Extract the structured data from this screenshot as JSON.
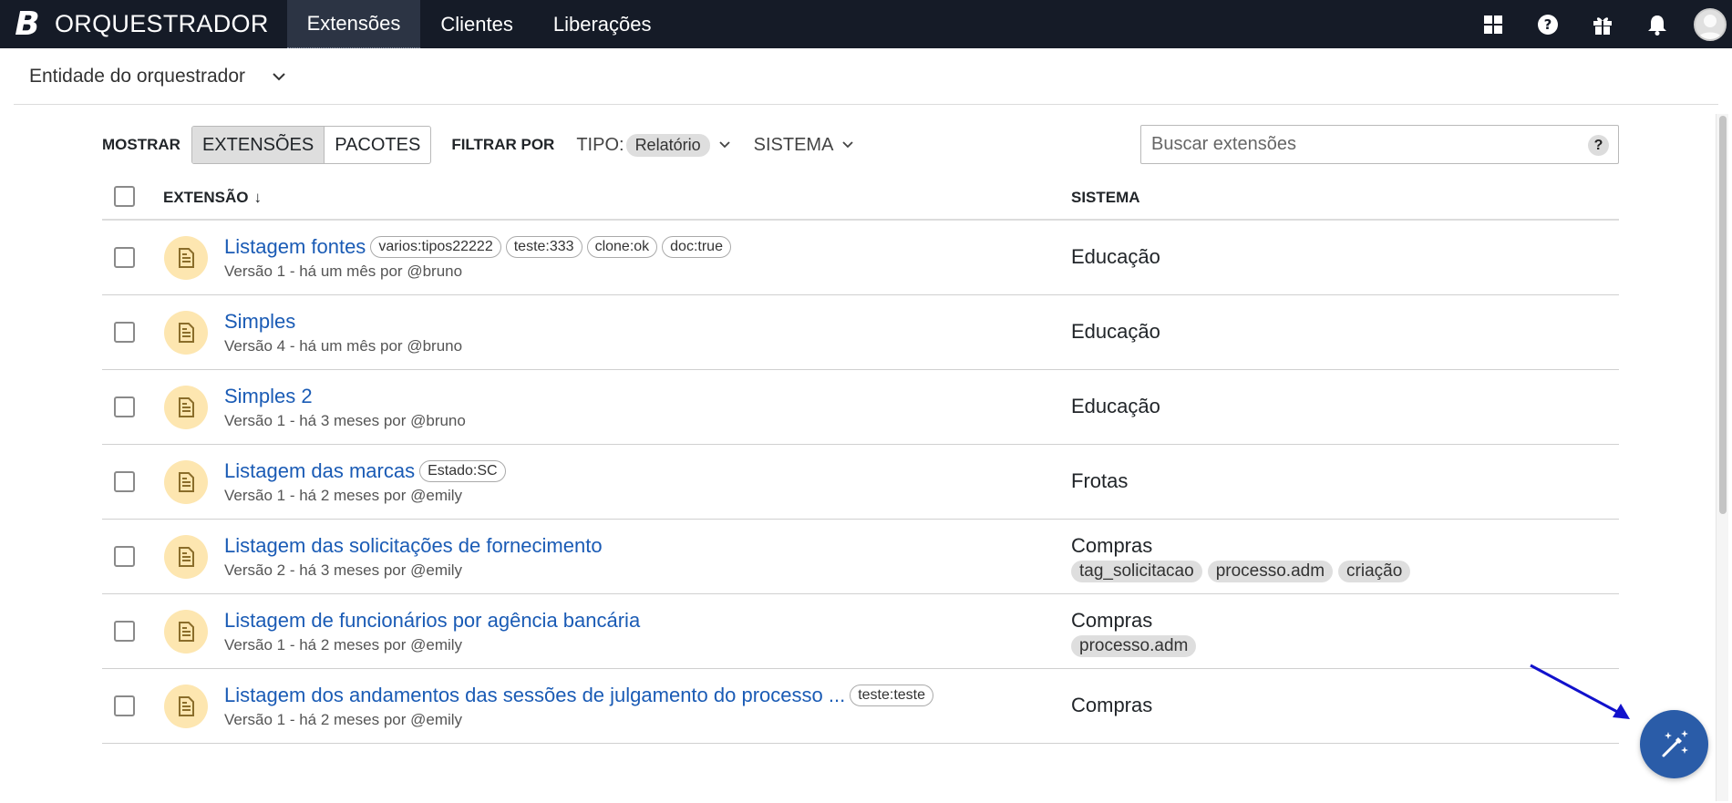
{
  "topbar": {
    "logo_letter": "B",
    "app_name": "ORQUESTRADOR",
    "tabs": [
      {
        "label": "Extensões",
        "active": true
      },
      {
        "label": "Clientes",
        "active": false
      },
      {
        "label": "Liberações",
        "active": false
      }
    ],
    "icons": [
      "apps-grid-icon",
      "help-circle-icon",
      "gift-icon",
      "bell-icon",
      "user-avatar-icon"
    ]
  },
  "entity": {
    "label": "Entidade do orquestrador"
  },
  "toolbar": {
    "show_label": "MOSTRAR",
    "show_options": [
      "EXTENSÕES",
      "PACOTES"
    ],
    "show_selected": "EXTENSÕES",
    "filter_label": "FILTRAR POR",
    "tipo_label": "TIPO:",
    "tipo_value": "Relatório",
    "sistema_label": "SISTEMA",
    "search_placeholder": "Buscar extensões",
    "help_label": "?"
  },
  "table": {
    "col_extension": "EXTENSÃO",
    "col_extension_sort": "↓",
    "col_system": "SISTEMA",
    "rows": [
      {
        "title": "Listagem fontes",
        "tags": [
          "varios:tipos22222",
          "teste:333",
          "clone:ok",
          "doc:true"
        ],
        "meta": "Versão 1 - há um mês por @bruno",
        "system": "Educação",
        "system_tags": []
      },
      {
        "title": "Simples",
        "tags": [],
        "meta": "Versão 4 - há um mês por @bruno",
        "system": "Educação",
        "system_tags": []
      },
      {
        "title": "Simples 2",
        "tags": [],
        "meta": "Versão 1 - há 3 meses por @bruno",
        "system": "Educação",
        "system_tags": []
      },
      {
        "title": "Listagem das marcas",
        "tags": [
          "Estado:SC"
        ],
        "meta": "Versão 1 - há 2 meses por @emily",
        "system": "Frotas",
        "system_tags": []
      },
      {
        "title": "Listagem das solicitações de fornecimento",
        "tags": [],
        "meta": "Versão 2 - há 3 meses por @emily",
        "system": "Compras",
        "system_tags": [
          "tag_solicitacao",
          "processo.adm",
          "criação"
        ]
      },
      {
        "title": "Listagem de funcionários por agência bancária",
        "tags": [],
        "meta": "Versão 1 - há 2 meses por @emily",
        "system": "Compras",
        "system_tags": [
          "processo.adm"
        ]
      },
      {
        "title": "Listagem dos andamentos das sessões de julgamento do processo ...",
        "tags": [
          "teste:teste"
        ],
        "meta": "Versão 1 - há 2 meses por @emily",
        "system": "Compras",
        "system_tags": []
      }
    ]
  },
  "colors": {
    "topbar_bg": "#151b27",
    "link": "#1a5bb5",
    "doc_badge": "#fde6b0",
    "doc_icon": "#8a6d2a",
    "fab": "#2a5ca8",
    "annotation_arrow": "#1111cc"
  },
  "fab_icon": "magic-wand-icon"
}
